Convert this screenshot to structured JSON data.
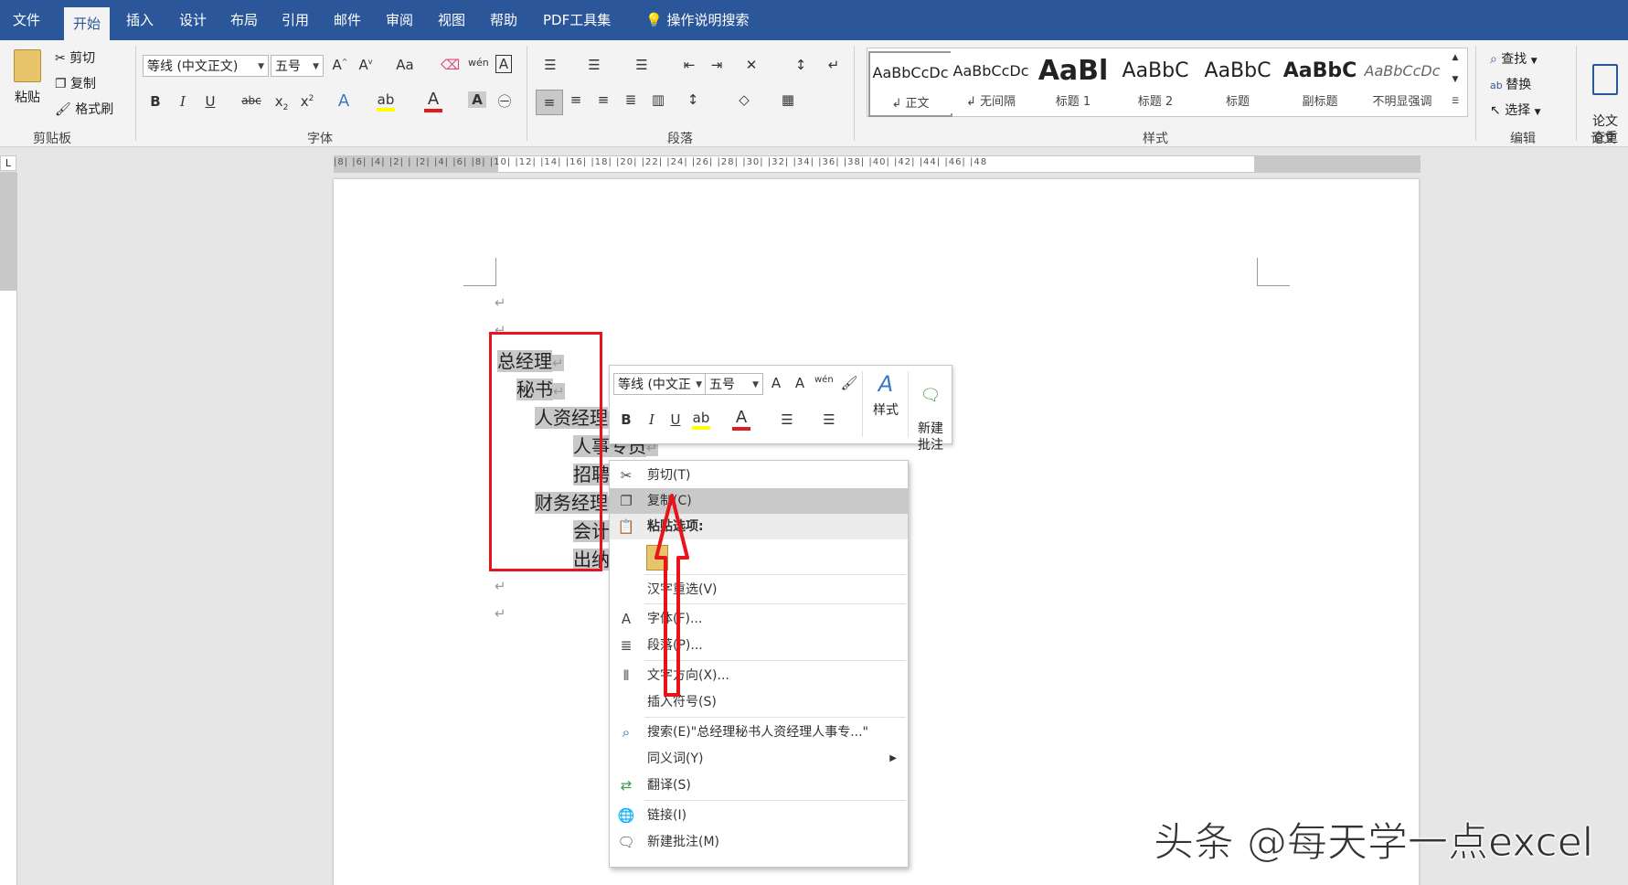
{
  "tabs": [
    "文件",
    "开始",
    "插入",
    "设计",
    "布局",
    "引用",
    "邮件",
    "审阅",
    "视图",
    "帮助",
    "PDF工具集",
    "操作说明搜索"
  ],
  "clipboard": {
    "paste": "粘贴",
    "cut": "剪切",
    "copy": "复制",
    "format_painter": "格式刷",
    "label": "剪贴板"
  },
  "font": {
    "name": "等线 (中文正文)",
    "size": "五号",
    "label": "字体"
  },
  "paragraph": {
    "label": "段落"
  },
  "styles": {
    "label": "样式",
    "items": [
      {
        "preview": "AaBbCcDc",
        "name": "↲ 正文"
      },
      {
        "preview": "AaBbCcDc",
        "name": "↲ 无间隔"
      },
      {
        "preview": "AaBl",
        "name": "标题 1"
      },
      {
        "preview": "AaBbC",
        "name": "标题 2"
      },
      {
        "preview": "AaBbC",
        "name": "标题"
      },
      {
        "preview": "AaBbC",
        "name": "副标题"
      },
      {
        "preview": "AaBbCcDc",
        "name": "不明显强调"
      }
    ]
  },
  "editing": {
    "find": "查找",
    "replace": "替换",
    "select": "选择",
    "label": "编辑"
  },
  "paper": {
    "check": "论文\n查重",
    "label": "论文"
  },
  "ruler_text": "|8| |6| |4| |2| | |2| |4| |6| |8| |10| |12| |14| |16| |18| |20| |22| |24| |26| |28| |30| |32| |34| |36| |38| |40| |42| |44| |46| |48",
  "document": {
    "lines": [
      "总经理",
      "秘书",
      "人资经理",
      "人事专员",
      "招聘",
      "财务经理",
      "会计",
      "出纳"
    ],
    "para_mark": "↵"
  },
  "mini_toolbar": {
    "font": "等线 (中文正",
    "size": "五号",
    "styles": "样式",
    "new_comment": "新建\n批注"
  },
  "context_menu": [
    {
      "label": "剪切(T)",
      "icon": "scissors-icon"
    },
    {
      "label": "复制(C)",
      "icon": "copy-icon"
    },
    {
      "label": "粘贴选项:",
      "icon": "paste-icon"
    },
    {
      "label": "汉字重选(V)",
      "icon": ""
    },
    {
      "label": "字体(F)...",
      "icon": "font-icon"
    },
    {
      "label": "段落(P)...",
      "icon": "paragraph-icon"
    },
    {
      "label": "文字方向(X)...",
      "icon": "text-direction-icon"
    },
    {
      "label": "插入符号(S)",
      "icon": ""
    },
    {
      "label": "搜索(E)\"总经理秘书人资经理人事专...\"",
      "icon": "search-icon"
    },
    {
      "label": "同义词(Y)",
      "icon": ""
    },
    {
      "label": "翻译(S)",
      "icon": "translate-icon"
    },
    {
      "label": "链接(I)",
      "icon": "link-icon"
    },
    {
      "label": "新建批注(M)",
      "icon": "comment-icon"
    }
  ],
  "watermark": "头条 @每天学一点excel",
  "colors": {
    "accent": "#2b579a",
    "annotation_red": "#e8131b",
    "font_red": "#e01b1b",
    "highlight_yellow": "#ffff00"
  }
}
